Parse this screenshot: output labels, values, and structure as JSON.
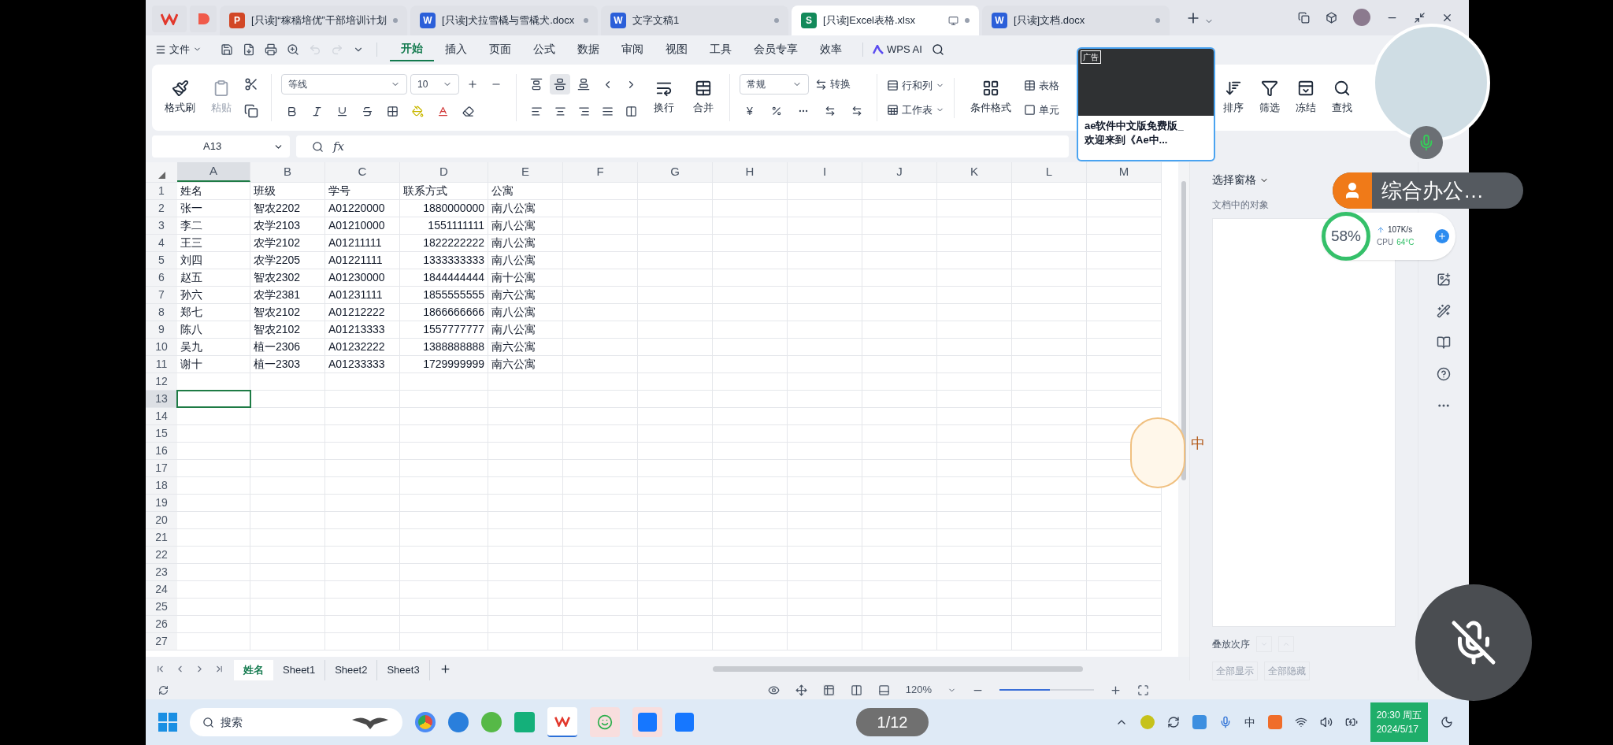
{
  "app_tabs": [
    {
      "badge": "P",
      "label": "[只读]“稼穑培优”干部培训计划",
      "color": "#d24726",
      "selected": false
    },
    {
      "badge": "W",
      "label": "[只读]犬拉雪橇与雪橇犬.docx",
      "color": "#2b5fd9",
      "selected": false
    },
    {
      "badge": "W",
      "label": "文字文稿1",
      "color": "#2b5fd9",
      "selected": false
    },
    {
      "badge": "S",
      "label": "[只读]Excel表格.xlsx",
      "color": "#138a5a",
      "selected": true
    },
    {
      "badge": "W",
      "label": "[只读]文档.docx",
      "color": "#2b5fd9",
      "selected": false
    }
  ],
  "menu": {
    "file": "文件",
    "items": [
      {
        "label": "开始",
        "selected": true
      },
      {
        "label": "插入",
        "selected": false
      },
      {
        "label": "页面",
        "selected": false
      },
      {
        "label": "公式",
        "selected": false
      },
      {
        "label": "数据",
        "selected": false
      },
      {
        "label": "审阅",
        "selected": false
      },
      {
        "label": "视图",
        "selected": false
      },
      {
        "label": "工具",
        "selected": false
      },
      {
        "label": "会员专享",
        "selected": false
      },
      {
        "label": "效率",
        "selected": false
      }
    ],
    "ai": "WPS AI"
  },
  "ribbon": {
    "paint_format": "格式刷",
    "paste": "粘贴",
    "paste_disabled": true,
    "font": "等线",
    "font_size": "10",
    "vertical_align": [
      {
        "selected": false
      },
      {
        "selected": true
      },
      {
        "selected": false
      }
    ],
    "wrap": "换行",
    "merge": "合并",
    "number_format": "常规",
    "currency": "¥",
    "convert": "转换",
    "rows_cols": "行和列",
    "worksheet": "工作表",
    "conditional": "条件格式",
    "table": "表格",
    "cell": "单元",
    "sort": "排序",
    "filter": "筛选",
    "freeze": "冻结",
    "find": "查找"
  },
  "formula_bar": {
    "name_box": "A13",
    "fx": "fx"
  },
  "sheet": {
    "columns": [
      {
        "label": "A",
        "selected": true
      },
      {
        "label": "B",
        "selected": false
      },
      {
        "label": "C",
        "selected": false
      },
      {
        "label": "D",
        "selected": false
      },
      {
        "label": "E",
        "selected": false
      },
      {
        "label": "F",
        "selected": false
      },
      {
        "label": "G",
        "selected": false
      },
      {
        "label": "H",
        "selected": false
      },
      {
        "label": "I",
        "selected": false
      },
      {
        "label": "J",
        "selected": false
      },
      {
        "label": "K",
        "selected": false
      },
      {
        "label": "L",
        "selected": false
      },
      {
        "label": "M",
        "selected": false
      }
    ],
    "rows": [
      {
        "number": "1",
        "selected": false,
        "cells": [
          "姓名",
          "班级",
          "学号",
          "联系方式",
          "公寓"
        ]
      },
      {
        "number": "2",
        "selected": false,
        "cells": [
          "张一",
          "智农2202",
          "A01220000",
          "1880000000",
          "南八公寓"
        ]
      },
      {
        "number": "3",
        "selected": false,
        "cells": [
          "李二",
          "农学2103",
          "A01210000",
          "1551111111",
          "南八公寓"
        ]
      },
      {
        "number": "4",
        "selected": false,
        "cells": [
          "王三",
          "农学2102",
          "A01211111",
          "1822222222",
          "南八公寓"
        ]
      },
      {
        "number": "5",
        "selected": false,
        "cells": [
          "刘四",
          "农学2205",
          "A01221111",
          "1333333333",
          "南八公寓"
        ]
      },
      {
        "number": "6",
        "selected": false,
        "cells": [
          "赵五",
          "智农2302",
          "A01230000",
          "1844444444",
          "南十公寓"
        ]
      },
      {
        "number": "7",
        "selected": false,
        "cells": [
          "孙六",
          "农学2381",
          "A01231111",
          "1855555555",
          "南六公寓"
        ]
      },
      {
        "number": "8",
        "selected": false,
        "cells": [
          "郑七",
          "智农2102",
          "A01212222",
          "1866666666",
          "南八公寓"
        ]
      },
      {
        "number": "9",
        "selected": false,
        "cells": [
          "陈八",
          "智农2102",
          "A01213333",
          "1557777777",
          "南八公寓"
        ]
      },
      {
        "number": "10",
        "selected": false,
        "cells": [
          "吴九",
          "植一2306",
          "A01232222",
          "1388888888",
          "南六公寓"
        ]
      },
      {
        "number": "11",
        "selected": false,
        "cells": [
          "谢十",
          "植一2303",
          "A01233333",
          "1729999999",
          "南六公寓"
        ]
      },
      {
        "number": "12",
        "selected": false,
        "cells": []
      },
      {
        "number": "13",
        "selected": true,
        "cells": []
      },
      {
        "number": "14",
        "selected": false,
        "cells": []
      },
      {
        "number": "15",
        "selected": false,
        "cells": []
      },
      {
        "number": "16",
        "selected": false,
        "cells": []
      },
      {
        "number": "17",
        "selected": false,
        "cells": []
      },
      {
        "number": "18",
        "selected": false,
        "cells": []
      },
      {
        "number": "19",
        "selected": false,
        "cells": []
      },
      {
        "number": "20",
        "selected": false,
        "cells": []
      },
      {
        "number": "21",
        "selected": false,
        "cells": []
      },
      {
        "number": "22",
        "selected": false,
        "cells": []
      },
      {
        "number": "23",
        "selected": false,
        "cells": []
      },
      {
        "number": "24",
        "selected": false,
        "cells": []
      },
      {
        "number": "25",
        "selected": false,
        "cells": []
      },
      {
        "number": "26",
        "selected": false,
        "cells": []
      },
      {
        "number": "27",
        "selected": false,
        "cells": []
      }
    ]
  },
  "sheet_tabs": [
    {
      "label": "姓名",
      "selected": true
    },
    {
      "label": "Sheet1",
      "selected": false
    },
    {
      "label": "Sheet2",
      "selected": false
    },
    {
      "label": "Sheet3",
      "selected": false
    }
  ],
  "side_pane": {
    "title": "选择窗格",
    "subtitle": "文档中的对象",
    "order": "叠放次序",
    "show_all": "全部显示",
    "hide_all": "全部隐藏"
  },
  "status_bar": {
    "zoom": "120%",
    "zoom_slider": {
      "level": 0.53
    }
  },
  "ad": {
    "tag": "广告",
    "lines": [
      "ae软件中文版免费版_",
      "欢迎来到《Ae中..."
    ]
  },
  "sticker": {
    "text": "中"
  },
  "call": {
    "name": "综合办公…"
  },
  "monitor": {
    "usage": "58%",
    "net": "107K/s",
    "cpu_label": "CPU",
    "cpu_temp": "64°C"
  },
  "taskbar": {
    "search": "搜索",
    "page_counter": "1/12",
    "ime": "中",
    "time": "20:30 周五",
    "date": "2024/5/17"
  }
}
